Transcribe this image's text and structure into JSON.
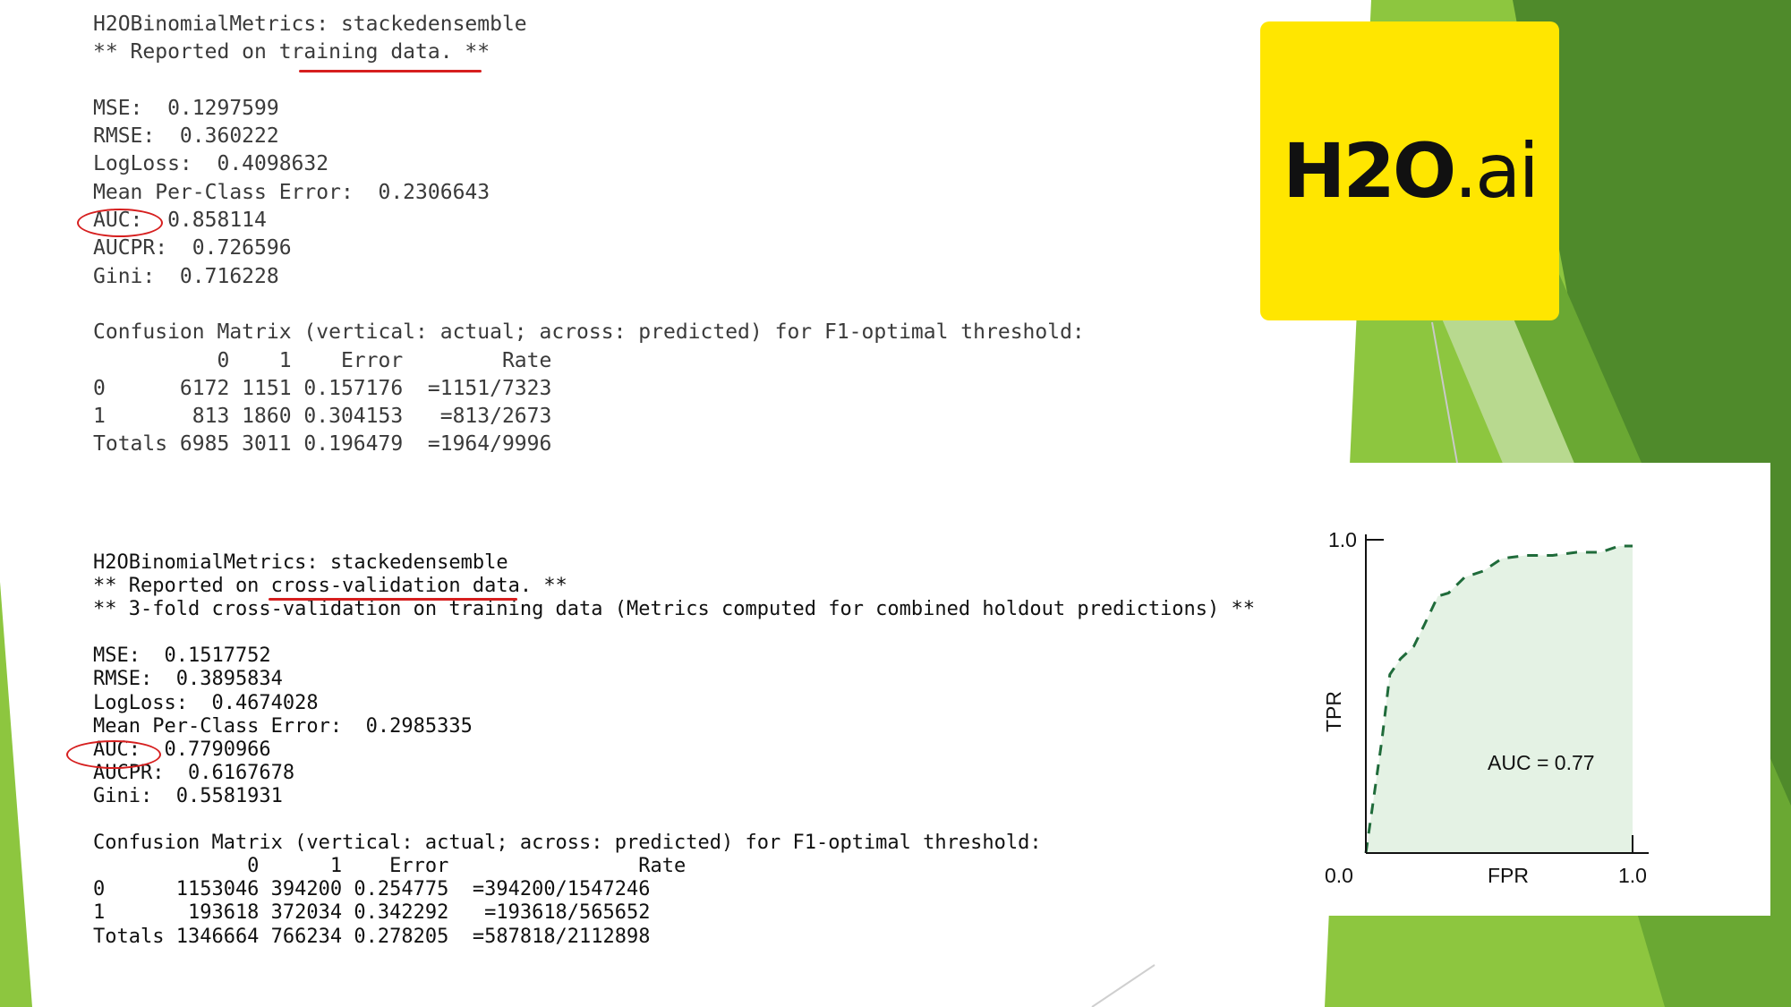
{
  "theme": {
    "background": "#ffffff",
    "accent_green_light": "#8dc63f",
    "accent_green_dark": "#4f8a2b",
    "annotation_red": "#d61f1f",
    "logo_yellow": "#ffe600",
    "roc_line": "#1f6b3a",
    "roc_fill": "#e4f2e4"
  },
  "training_report": {
    "lines": [
      "H2OBinomialMetrics: stackedensemble",
      "** Reported on training data. **",
      "",
      "MSE:  0.1297599",
      "RMSE:  0.360222",
      "LogLoss:  0.4098632",
      "Mean Per-Class Error:  0.2306643",
      "AUC:  0.858114",
      "AUCPR:  0.726596",
      "Gini:  0.716228",
      "",
      "Confusion Matrix (vertical: actual; across: predicted) for F1-optimal threshold:",
      "          0    1    Error        Rate",
      "0      6172 1151 0.157176  =1151/7323",
      "1       813 1860 0.304153   =813/2673",
      "Totals 6985 3011 0.196479  =1964/9996"
    ]
  },
  "cv_report": {
    "lines": [
      "H2OBinomialMetrics: stackedensemble",
      "** Reported on cross-validation data. **",
      "** 3-fold cross-validation on training data (Metrics computed for combined holdout predictions) **",
      "",
      "MSE:  0.1517752",
      "RMSE:  0.3895834",
      "LogLoss:  0.4674028",
      "Mean Per-Class Error:  0.2985335",
      "AUC:  0.7790966",
      "AUCPR:  0.6167678",
      "Gini:  0.5581931",
      "",
      "Confusion Matrix (vertical: actual; across: predicted) for F1-optimal threshold:",
      "             0      1    Error                Rate",
      "0      1153046 394200 0.254775  =394200/1547246",
      "1       193618 372034 0.342292   =193618/565652",
      "Totals 1346664 766234 0.278205  =587818/2112898"
    ]
  },
  "logo": {
    "main": "H2O",
    "suffix": ".ai"
  },
  "chart_data": {
    "type": "line",
    "ylabel": "TPR",
    "xlabel": "FPR",
    "x_tick_labels": [
      "0.0",
      "1.0"
    ],
    "y_tick_labels": [
      "1.0"
    ],
    "xlim": [
      0,
      1
    ],
    "ylim": [
      0,
      1
    ],
    "annotation": "AUC = 0.77",
    "series": [
      {
        "style": "dashed",
        "x": [
          0.0,
          0.02,
          0.06,
          0.09,
          0.13,
          0.18,
          0.22,
          0.27,
          0.31,
          0.37,
          0.44,
          0.51,
          0.6,
          0.7,
          0.79,
          0.88,
          0.95,
          1.0
        ],
        "y": [
          0.0,
          0.12,
          0.36,
          0.57,
          0.62,
          0.66,
          0.73,
          0.82,
          0.83,
          0.88,
          0.9,
          0.94,
          0.95,
          0.95,
          0.96,
          0.96,
          0.98,
          0.98
        ]
      }
    ]
  }
}
